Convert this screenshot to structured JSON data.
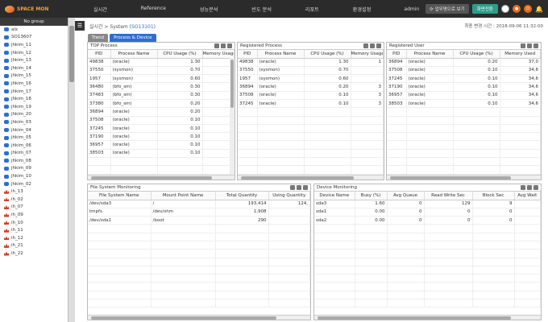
{
  "app": {
    "logo_text": "SPACE MON"
  },
  "menu": [
    "실시간",
    "Reference",
    "성능분석",
    "빈도 분석",
    "리포트",
    "환경설정"
  ],
  "header": {
    "user": "admin",
    "view_button": "업무명으로 보기",
    "green_button": "화면전환"
  },
  "sidebar": {
    "title": "No group",
    "items": [
      {
        "label": "alx",
        "icon": "db"
      },
      {
        "label": "SO13607",
        "icon": "db"
      },
      {
        "label": "jhkim_11",
        "icon": "db"
      },
      {
        "label": "jhkim_12",
        "icon": "db"
      },
      {
        "label": "jhkim_13",
        "icon": "db"
      },
      {
        "label": "jhkim_14",
        "icon": "db"
      },
      {
        "label": "jhkim_15",
        "icon": "db"
      },
      {
        "label": "jhkim_16",
        "icon": "db"
      },
      {
        "label": "jhkim_17",
        "icon": "db"
      },
      {
        "label": "jhkim_18",
        "icon": "db"
      },
      {
        "label": "jhkim_19",
        "icon": "db"
      },
      {
        "label": "jhkim_20",
        "icon": "db"
      },
      {
        "label": "jhkim_03",
        "icon": "db"
      },
      {
        "label": "jhkim_04",
        "icon": "db"
      },
      {
        "label": "jhkim_05",
        "icon": "db"
      },
      {
        "label": "jhkim_06",
        "icon": "db"
      },
      {
        "label": "jhkim_07",
        "icon": "db"
      },
      {
        "label": "jhkim_08",
        "icon": "db"
      },
      {
        "label": "jhkim_09",
        "icon": "db"
      },
      {
        "label": "jhkim_10",
        "icon": "db"
      },
      {
        "label": "jhkim_02",
        "icon": "db"
      },
      {
        "label": "ih_13",
        "icon": "crown"
      },
      {
        "label": "ih_02",
        "icon": "crown"
      },
      {
        "label": "ih_07",
        "icon": "crown"
      },
      {
        "label": "ih_09",
        "icon": "crown"
      },
      {
        "label": "ih_10",
        "icon": "crown"
      },
      {
        "label": "ih_11",
        "icon": "crown"
      },
      {
        "label": "ih_12",
        "icon": "crown"
      },
      {
        "label": "ih_21",
        "icon": "crown"
      },
      {
        "label": "ih_22",
        "icon": "crown"
      }
    ]
  },
  "page": {
    "breadcrumb_prefix": "실시간 > System (",
    "breadcrumb_host": "SO13101",
    "breadcrumb_suffix": ")",
    "last_update": "최종 변경 시간 : 2018-09-06 11:32:00",
    "tabs": [
      "Trend",
      "Process & Device"
    ]
  },
  "top_process": {
    "title": "TOP Process",
    "columns": [
      "PID",
      "Process Name",
      "CPU Usage (%)",
      "Memory Usage"
    ],
    "rows": [
      [
        "49838",
        "(oracle)",
        "1.30",
        ""
      ],
      [
        "37550",
        "(sysmon)",
        "0.70",
        ""
      ],
      [
        "1957",
        "(sysmon)",
        "0.60",
        ""
      ],
      [
        "36480",
        "(bfo_sm)",
        "0.30",
        ""
      ],
      [
        "37483",
        "(bfo_sm)",
        "0.30",
        ""
      ],
      [
        "37380",
        "(bfo_sm)",
        "0.20",
        ""
      ],
      [
        "36894",
        "(oracle)",
        "0.20",
        ""
      ],
      [
        "37508",
        "(oracle)",
        "0.10",
        ""
      ],
      [
        "37245",
        "(oracle)",
        "0.10",
        ""
      ],
      [
        "37190",
        "(oracle)",
        "0.10",
        ""
      ],
      [
        "36957",
        "(oracle)",
        "0.10",
        ""
      ],
      [
        "38503",
        "(oracle)",
        "0.10",
        ""
      ]
    ]
  },
  "registered_process": {
    "title": "Registered Process",
    "columns": [
      "PID",
      "Process Name",
      "CPU Usage (%)",
      "Memory Usage"
    ],
    "rows": [
      [
        "49838",
        "(oracle)",
        "1.30",
        "1"
      ],
      [
        "37550",
        "(sysmon)",
        "0.70",
        ""
      ],
      [
        "1957",
        "(sysmon)",
        "0.60",
        ""
      ],
      [
        "36894",
        "(oracle)",
        "0.20",
        "3"
      ],
      [
        "37508",
        "(oracle)",
        "0.10",
        "3"
      ],
      [
        "37245",
        "(oracle)",
        "0.10",
        "3"
      ]
    ]
  },
  "registered_user": {
    "title": "Registered User",
    "columns": [
      "PID",
      "Process Name",
      "CPU Usage (%)",
      "Memory Used"
    ],
    "rows": [
      [
        "36894",
        "(oracle)",
        "0.20",
        "37,0"
      ],
      [
        "37508",
        "(oracle)",
        "0.10",
        "34,6"
      ],
      [
        "37245",
        "(oracle)",
        "0.10",
        "34,6"
      ],
      [
        "37190",
        "(oracle)",
        "0.10",
        "34,6"
      ],
      [
        "36957",
        "(oracle)",
        "0.10",
        "34,6"
      ],
      [
        "38503",
        "(oracle)",
        "0.10",
        "34,6"
      ]
    ]
  },
  "file_system": {
    "title": "File System Monitoring",
    "columns": [
      "File System Name",
      "Mount Point Name",
      "Total Quantity",
      "Using Quantity"
    ],
    "rows": [
      [
        "/dev/sda3",
        "/",
        "193,414",
        "124,"
      ],
      [
        "tmpfs",
        "/dev/shm",
        "1,908",
        ""
      ],
      [
        "/dev/sda1",
        "/boot",
        "290",
        ""
      ]
    ]
  },
  "device": {
    "title": "Device Monitoring",
    "columns": [
      "Device Name",
      "Busy (%)",
      "Avg Queue",
      "Read Write Sec",
      "Block Sec",
      "Avg Wait"
    ],
    "rows": [
      [
        "sda3",
        "1.60",
        "0",
        "129",
        "9",
        ""
      ],
      [
        "sda1",
        "0.00",
        "0",
        "0",
        "0",
        ""
      ],
      [
        "sda2",
        "0.00",
        "0",
        "0",
        "0",
        ""
      ]
    ]
  }
}
